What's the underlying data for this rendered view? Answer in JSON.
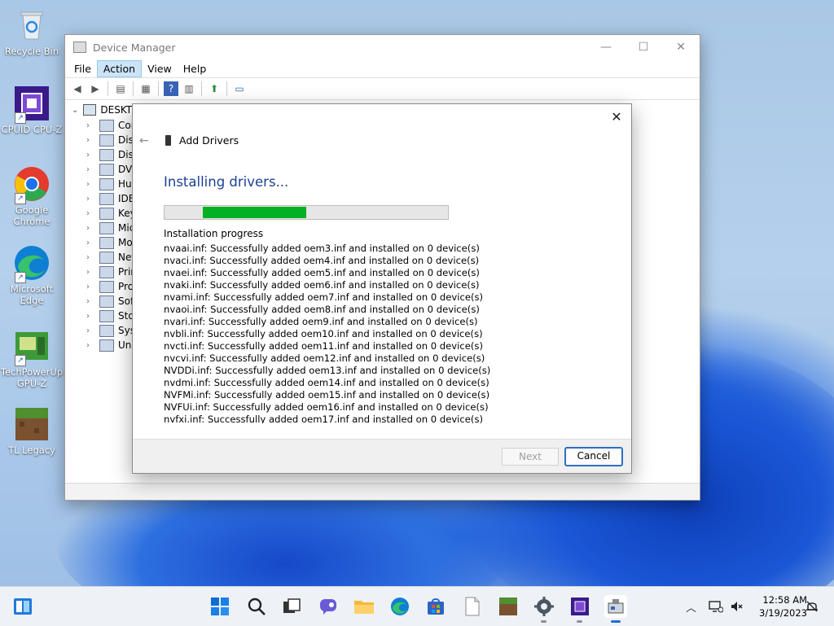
{
  "desktop": {
    "icons": [
      {
        "label": "Recycle Bin"
      },
      {
        "label": "CPUID CPU-Z"
      },
      {
        "label": "Google Chrome"
      },
      {
        "label": "Microsoft Edge"
      },
      {
        "label": "TechPowerUp GPU-Z"
      },
      {
        "label": "TL Legacy"
      }
    ]
  },
  "device_manager": {
    "title": "Device Manager",
    "menu": [
      "File",
      "Action",
      "View",
      "Help"
    ],
    "window_controls": {
      "minimize": "—",
      "maximize": "☐",
      "close": "✕"
    },
    "tree": {
      "root": "DESKTO",
      "nodes": [
        "Cor",
        "Disk",
        "Disp",
        "DVD",
        "Hur",
        "IDE",
        "Key",
        "Mic",
        "Mo",
        "Net",
        "Prir",
        "Pro",
        "Soft",
        "Stor",
        "Syst",
        "Uni"
      ]
    }
  },
  "dialog": {
    "close": "✕",
    "back": "←",
    "header": "Add Drivers",
    "heading": "Installing drivers...",
    "progress": {
      "start": 0.135,
      "end": 0.5
    },
    "progress_label": "Installation progress",
    "log": [
      "nvaai.inf: Successfully added oem3.inf and installed on 0 device(s)",
      "nvaci.inf: Successfully added oem4.inf and installed on 0 device(s)",
      "nvaei.inf: Successfully added oem5.inf and installed on 0 device(s)",
      "nvaki.inf: Successfully added oem6.inf and installed on 0 device(s)",
      "nvami.inf: Successfully added oem7.inf and installed on 0 device(s)",
      "nvaoi.inf: Successfully added oem8.inf and installed on 0 device(s)",
      "nvari.inf: Successfully added oem9.inf and installed on 0 device(s)",
      "nvbli.inf: Successfully added oem10.inf and installed on 0 device(s)",
      "nvcti.inf: Successfully added oem11.inf and installed on 0 device(s)",
      "nvcvi.inf: Successfully added oem12.inf and installed on 0 device(s)",
      "NVDDi.inf: Successfully added oem13.inf and installed on 0 device(s)",
      "nvdmi.inf: Successfully added oem14.inf and installed on 0 device(s)",
      "NVFMi.inf: Successfully added oem15.inf and installed on 0 device(s)",
      "NVFUi.inf: Successfully added oem16.inf and installed on 0 device(s)",
      "nvfxi.inf: Successfully added oem17.inf and installed on 0 device(s)"
    ],
    "buttons": {
      "next": "Next",
      "cancel": "Cancel"
    }
  },
  "taskbar": {
    "time": "12:58 AM",
    "date": "3/19/2023"
  },
  "colors": {
    "accent": "#1c3f95",
    "progress": "#06b025",
    "cancel_border": "#2d6fc6"
  }
}
